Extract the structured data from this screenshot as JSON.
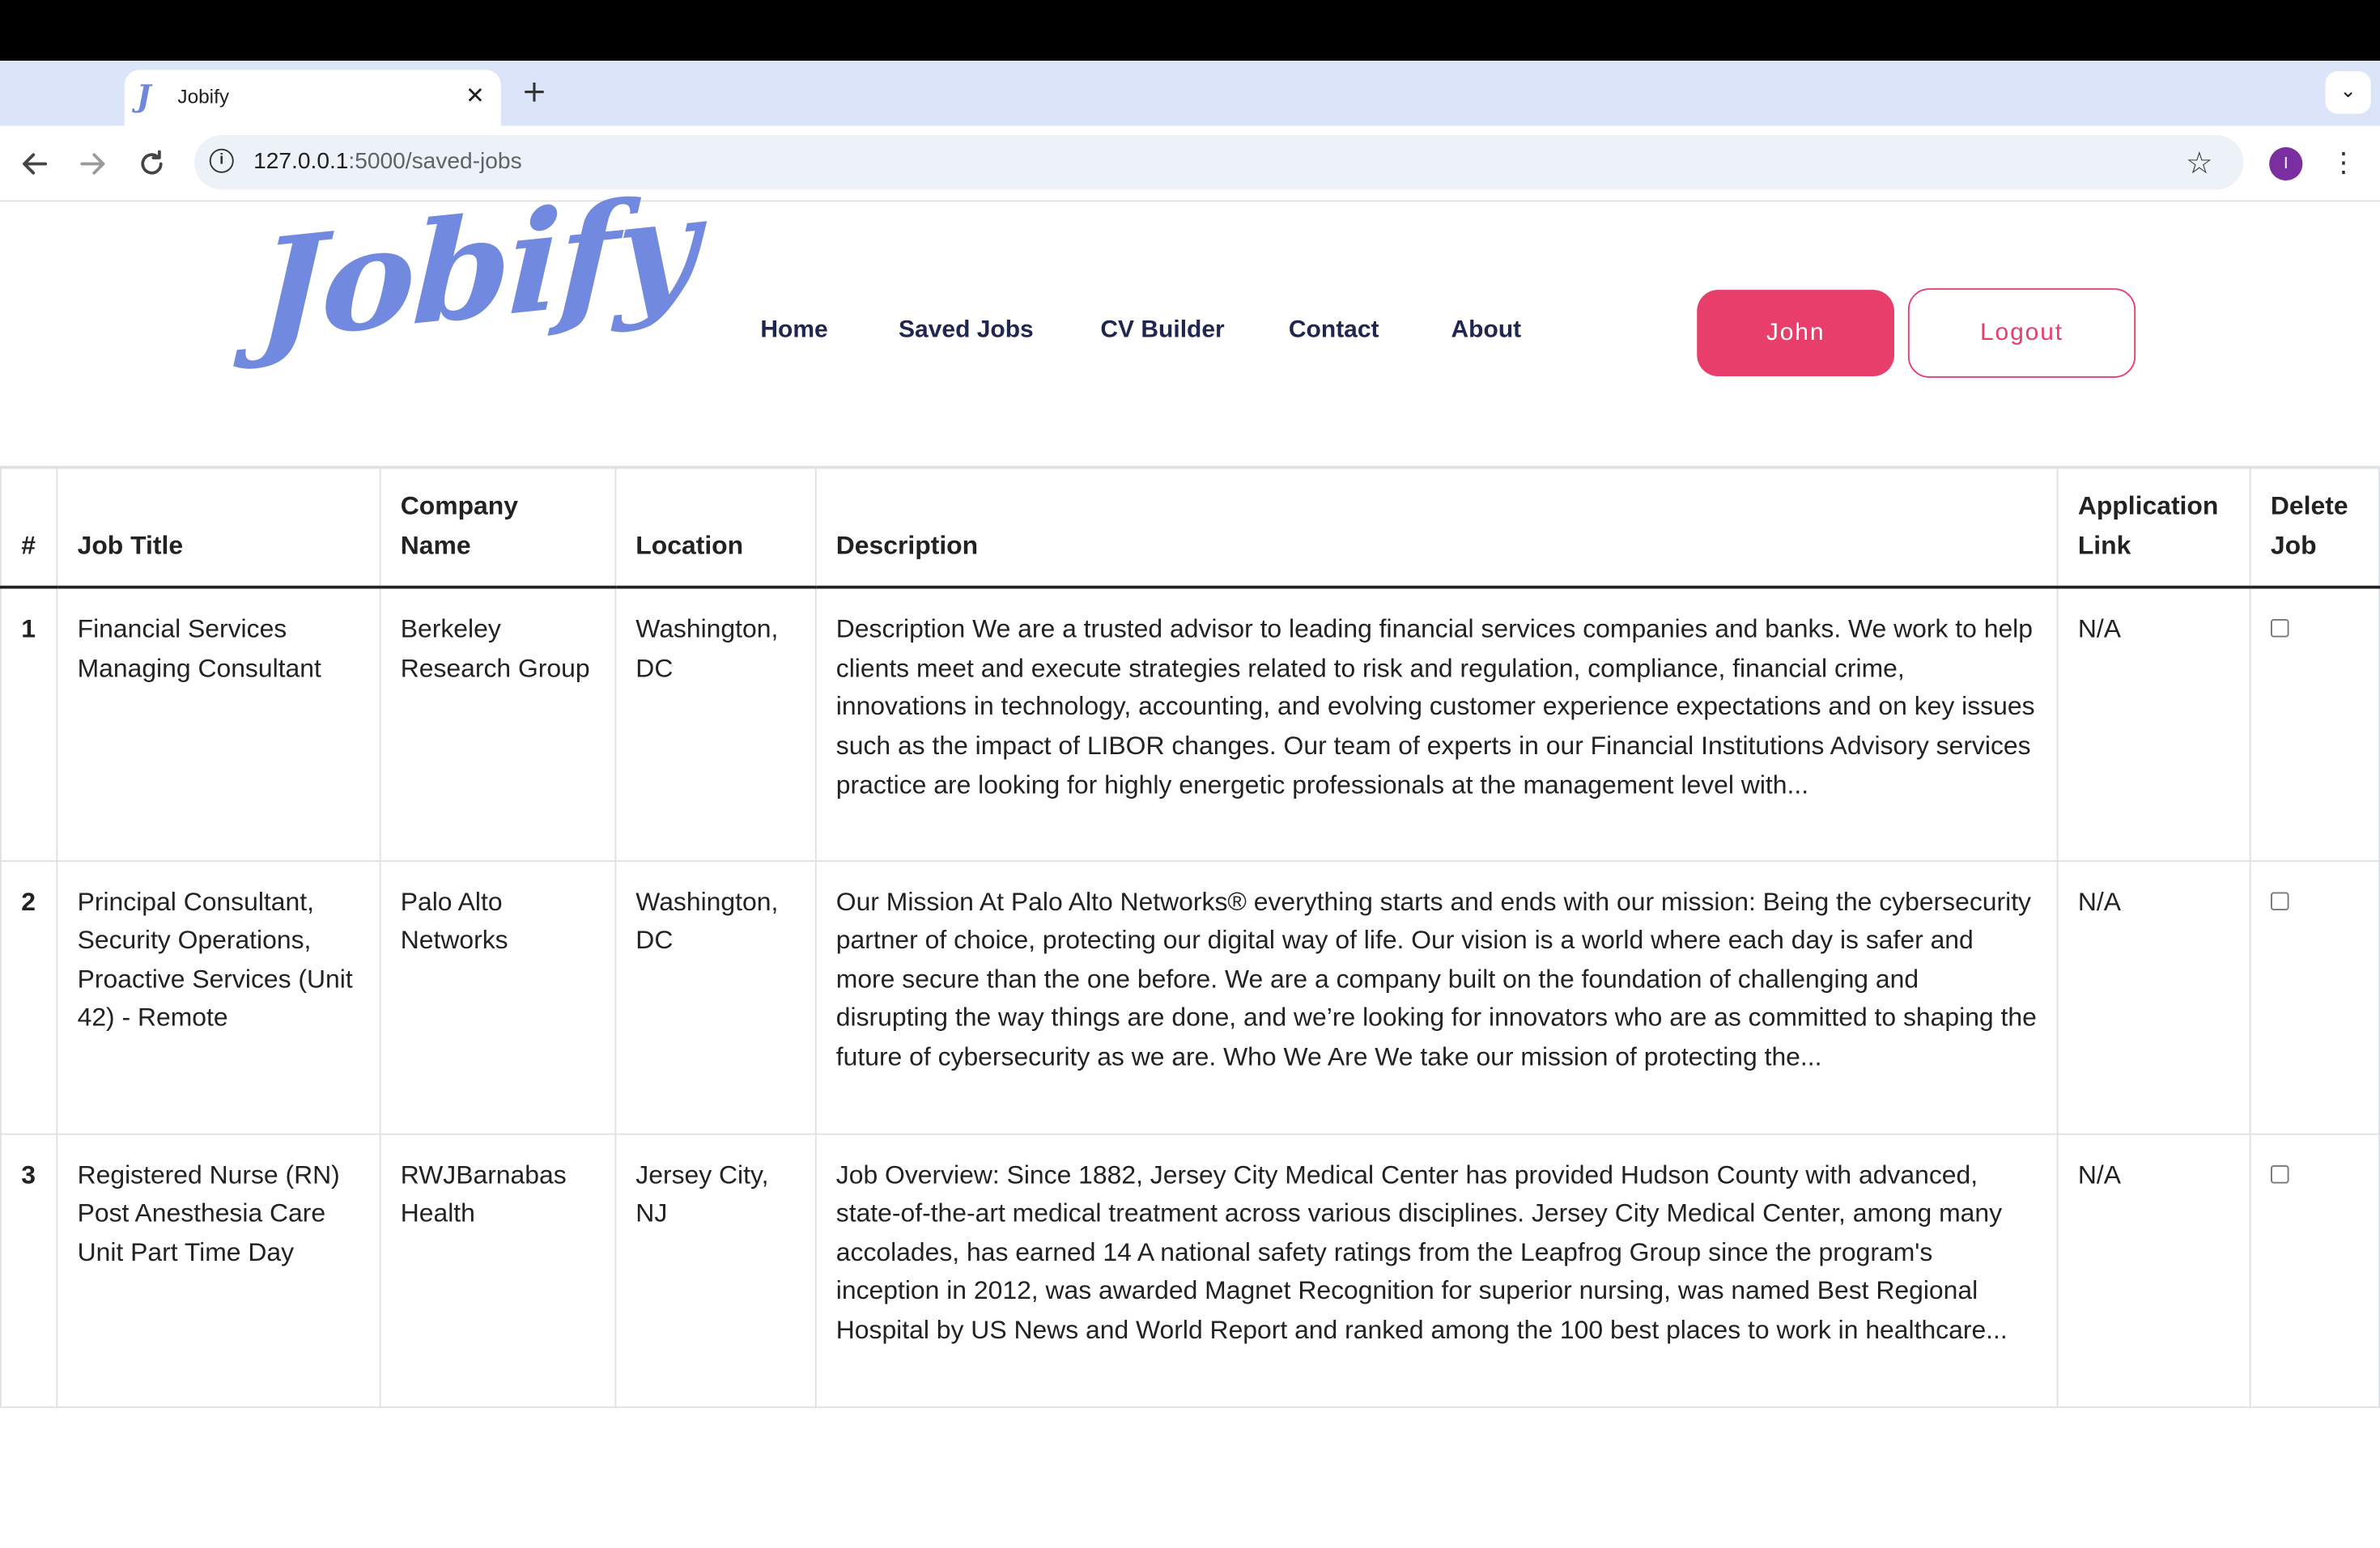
{
  "browser": {
    "tab_title": "Jobify",
    "tab_favicon": "J",
    "close_glyph": "✕",
    "new_tab_glyph": "+",
    "tab_menu_glyph": "⌄",
    "url_host": "127.0.0.1",
    "url_path": ":5000/saved-jobs",
    "profile_initial": "I",
    "icons": {
      "back": "arrow-left-icon",
      "forward": "arrow-right-icon",
      "reload": "reload-icon",
      "info": "info-icon",
      "bookmark": "star-icon",
      "menu": "kebab-menu-icon"
    }
  },
  "site": {
    "logo": "Jobify",
    "nav": {
      "home": "Home",
      "saved_jobs": "Saved Jobs",
      "cv_builder": "CV Builder",
      "contact": "Contact",
      "about": "About"
    },
    "user_button": "John",
    "logout_button": "Logout",
    "colors": {
      "accent": "#e83e6c",
      "logo": "#7289e0",
      "nav_text": "#1f2750"
    }
  },
  "table": {
    "headers": {
      "num": "#",
      "title": "Job Title",
      "company": "Company Name",
      "location": "Location",
      "description": "Description",
      "link": "Application Link",
      "delete": "Delete Job"
    },
    "rows": [
      {
        "num": "1",
        "title": "Financial Services Managing Consultant",
        "company": "Berkeley Research Group",
        "location": "Washington, DC",
        "description": "Description We are a trusted advisor to leading financial services companies and banks. We work to help clients meet and execute strategies related to risk and regulation, compliance, financial crime, innovations in technology, accounting, and evolving customer experience expectations and on key issues such as the impact of LIBOR changes. Our team of experts in our Financial Institutions Advisory services practice are looking for highly energetic professionals at the management level with...",
        "link": "N/A",
        "checked": false
      },
      {
        "num": "2",
        "title": "Principal Consultant, Security Operations, Proactive Services (Unit 42) - Remote",
        "company": "Palo Alto Networks",
        "location": "Washington, DC",
        "description": "Our Mission At Palo Alto Networks® everything starts and ends with our mission: Being the cybersecurity partner of choice, protecting our digital way of life. Our vision is a world where each day is safer and more secure than the one before. We are a company built on the foundation of challenging and disrupting the way things are done, and we’re looking for innovators who are as committed to shaping the future of cybersecurity as we are. Who We Are We take our mission of protecting the...",
        "link": "N/A",
        "checked": false
      },
      {
        "num": "3",
        "title": "Registered Nurse (RN) Post Anesthesia Care Unit Part Time Day",
        "company": "RWJBarnabas Health",
        "location": "Jersey City, NJ",
        "description": "Job Overview: Since 1882, Jersey City Medical Center has provided Hudson County with advanced, state-of-the-art medical treatment across various disciplines. Jersey City Medical Center, among many accolades, has earned 14 A national safety ratings from the Leapfrog Group since the program's inception in 2012, was awarded Magnet Recognition for superior nursing, was named Best Regional Hospital by US News and World Report and ranked among the 100 best places to work in healthcare...",
        "link": "N/A",
        "checked": false
      }
    ]
  }
}
